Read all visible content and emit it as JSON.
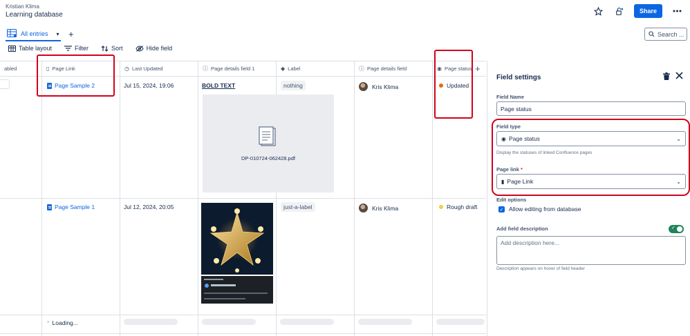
{
  "header": {
    "owner": "Kristian Klima",
    "title": "Learning database",
    "share_label": "Share"
  },
  "views": {
    "active_label": "All entries"
  },
  "search": {
    "placeholder": "Search ..."
  },
  "toolbar": {
    "table_layout": "Table layout",
    "filter": "Filter",
    "sort": "Sort",
    "hide_field": "Hide field"
  },
  "table": {
    "columns": {
      "c0": "abled",
      "c1": "Page Link",
      "c2": "Last Updated",
      "c3": "Page details field 1",
      "c4": "Label",
      "c5": "Page details field",
      "c6": "Page status"
    },
    "rows": [
      {
        "page_link": "Page Sample 2",
        "last_updated": "Jul 15, 2024, 19:06",
        "details": "BOLD TEXT",
        "attachment": "DP-010724-062428.pdf",
        "label": "nothing",
        "user": "Kris Klima",
        "status": "Updated",
        "status_color": "#e56910"
      },
      {
        "page_link": "Page Sample 1",
        "last_updated": "Jul 12, 2024, 20:05",
        "label": "just-a-label",
        "user": "Kris Klima",
        "status": "Rough draft",
        "status_color": "#f5cd47"
      }
    ],
    "loading": "Loading..."
  },
  "panel": {
    "title": "Field settings",
    "field_name_label": "Field Name",
    "field_name_value": "Page status",
    "field_type_label": "Field type",
    "field_type_value": "Page status",
    "field_type_help": "Display the statuses of linked Confluence pages",
    "page_link_label": "Page link",
    "page_link_required": "*",
    "page_link_value": "Page Link",
    "edit_options_label": "Edit options",
    "allow_editing": "Allow editing from database",
    "add_desc_label": "Add field description",
    "desc_placeholder": "Add description here...",
    "desc_help": "Description appears on hover of field header"
  },
  "colors": {
    "accent": "#0c66e4",
    "highlight": "#d0021b",
    "toggle_on": "#1f845a"
  }
}
